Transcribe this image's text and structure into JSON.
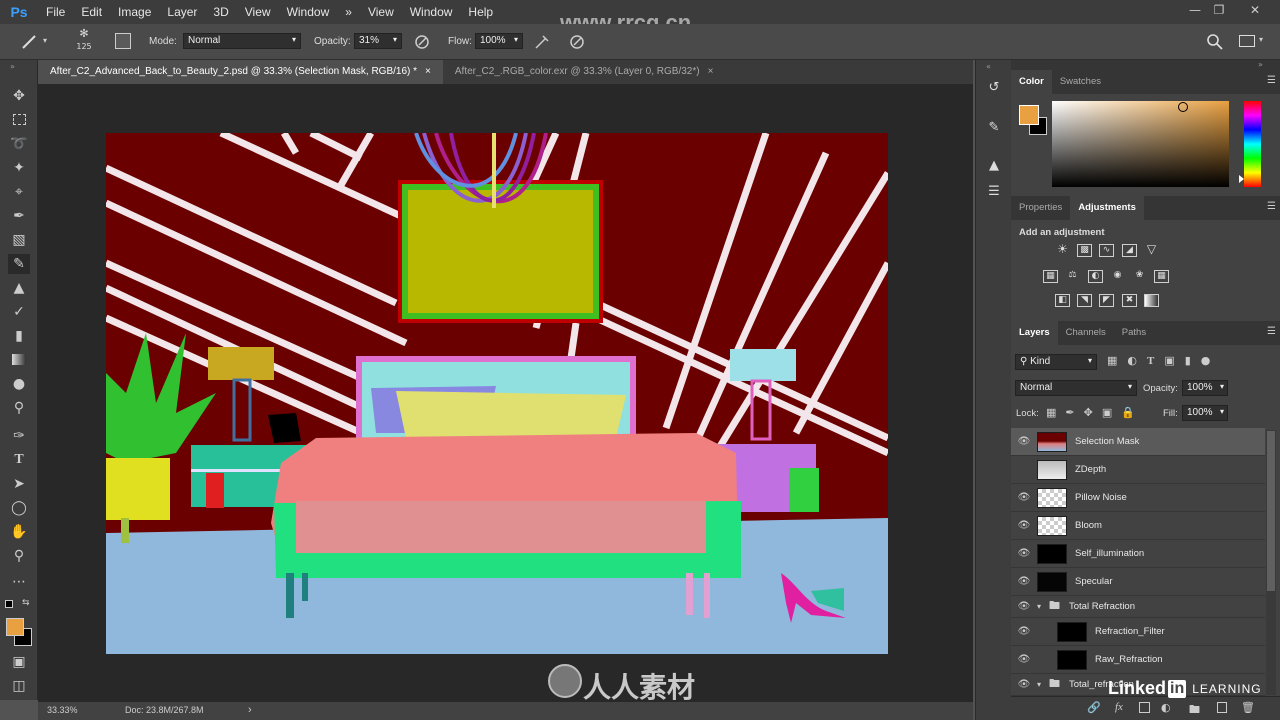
{
  "app": {
    "logo": "Ps"
  },
  "menu": [
    "File",
    "Edit",
    "Image",
    "Layer",
    "3D",
    "View",
    "Window",
    "»",
    "View",
    "Window",
    "Help"
  ],
  "options": {
    "brush_size": "125",
    "mode_label": "Mode:",
    "mode_value": "Normal",
    "opacity_label": "Opacity:",
    "opacity_value": "31%",
    "flow_label": "Flow:",
    "flow_value": "100%"
  },
  "tabs": [
    {
      "label": "After_C2_Advanced_Back_to_Beauty_2.psd @ 33.3% (Selection Mask, RGB/16) *",
      "close": "×"
    },
    {
      "label": "After_C2_.RGB_color.exr @ 33.3% (Layer 0, RGB/32*)",
      "close": "×"
    }
  ],
  "status": {
    "zoom": "33.33%",
    "doc": "Doc: 23.8M/267.8M",
    "arrow": "›"
  },
  "color_panel": {
    "tab_color": "Color",
    "tab_swatches": "Swatches",
    "foreground": "#e8a040",
    "background": "#000000"
  },
  "props_panel": {
    "tab_properties": "Properties",
    "tab_adjustments": "Adjustments",
    "add_adjustment": "Add an adjustment"
  },
  "layers_panel": {
    "tab_layers": "Layers",
    "tab_channels": "Channels",
    "tab_paths": "Paths",
    "filter_kind": "Kind",
    "blend_mode": "Normal",
    "opacity_label": "Opacity:",
    "opacity_value": "100%",
    "lock_label": "Lock:",
    "fill_label": "Fill:",
    "fill_value": "100%",
    "layers": [
      {
        "name": "Selection Mask",
        "visible": true,
        "selected": true
      },
      {
        "name": "ZDepth",
        "visible": false
      },
      {
        "name": "Pillow Noise",
        "visible": true
      },
      {
        "name": "Bloom",
        "visible": true
      },
      {
        "name": "Self_illumination",
        "visible": true
      },
      {
        "name": "Specular",
        "visible": true
      },
      {
        "name": "Total Refraction",
        "visible": true,
        "group": true
      },
      {
        "name": "Refraction_Filter",
        "visible": true
      },
      {
        "name": "Raw_Refraction",
        "visible": true
      },
      {
        "name": "Total_refraction",
        "visible": true,
        "group": true
      }
    ]
  },
  "watermarks": {
    "top": "www.rrcg.cn",
    "bottom": "人人素材",
    "linkedin": "Linked",
    "linkedin_in": "in",
    "learning": "LEARNING"
  }
}
